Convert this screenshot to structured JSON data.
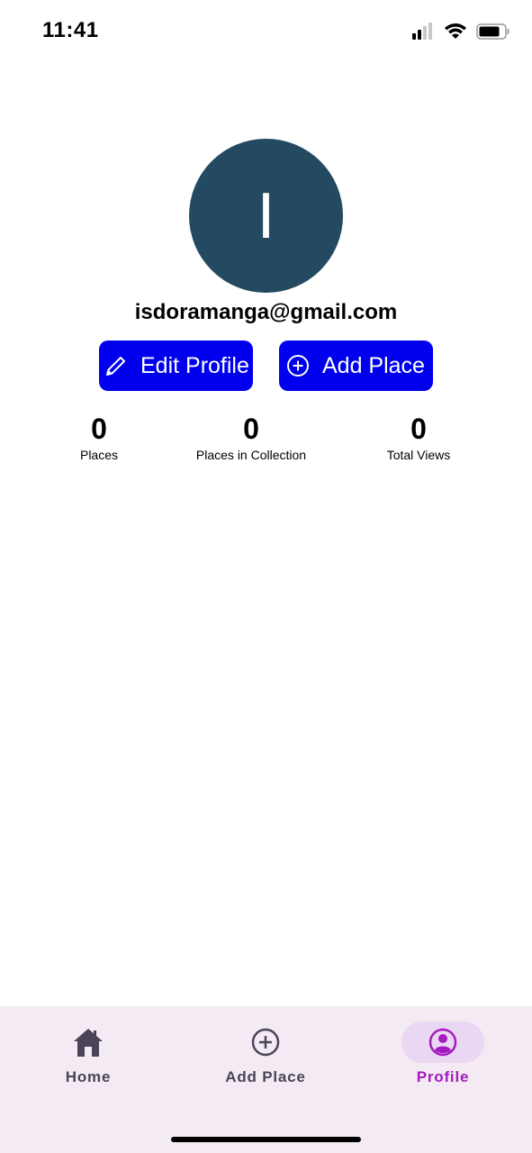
{
  "status_bar": {
    "time": "11:41",
    "icons": [
      "cellular-signal-icon",
      "wifi-icon",
      "battery-icon"
    ]
  },
  "profile": {
    "avatar_letter": "I",
    "avatar_color": "#244a62",
    "email": "isdoramanga@gmail.com"
  },
  "actions": {
    "edit_profile": {
      "label": "Edit Profile",
      "icon": "pencil-icon"
    },
    "add_place": {
      "label": "Add Place",
      "icon": "add-circle-icon"
    },
    "button_color": "#0000ee"
  },
  "stats": [
    {
      "value": "0",
      "label": "Places"
    },
    {
      "value": "0",
      "label": "Places in Collection"
    },
    {
      "value": "0",
      "label": "Total Views"
    }
  ],
  "bottom_nav": {
    "items": [
      {
        "label": "Home",
        "icon": "home-icon",
        "active": false
      },
      {
        "label": "Add Place",
        "icon": "add-circle-icon",
        "active": false
      },
      {
        "label": "Profile",
        "icon": "profile-icon",
        "active": true
      }
    ],
    "active_color": "#a51bbf",
    "background": "#f3eaf4"
  }
}
